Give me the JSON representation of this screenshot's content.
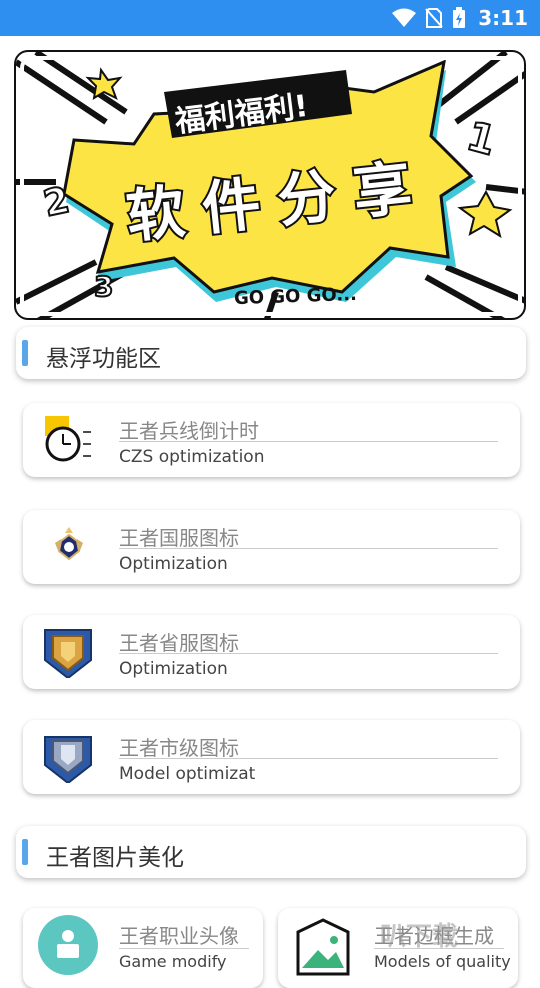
{
  "status_bar": {
    "time": "3:11"
  },
  "banner": {
    "tag_text": "福利福利!",
    "headline": "软件分享",
    "footer_text": "GO GO GO...",
    "numbers": [
      "1",
      "2",
      "3"
    ]
  },
  "sections": [
    {
      "title": "悬浮功能区"
    },
    {
      "title": "王者图片美化"
    }
  ],
  "cards": [
    {
      "title": "王者兵线倒计时",
      "subtitle": "CZS optimization",
      "icon": "stopwatch-icon"
    },
    {
      "title": "王者国服图标",
      "subtitle": "Optimization",
      "icon": "national-server-badge-icon"
    },
    {
      "title": "王者省服图标",
      "subtitle": "Optimization",
      "icon": "province-badge-icon"
    },
    {
      "title": "王者市级图标",
      "subtitle": "Model optimizat",
      "icon": "city-badge-icon"
    }
  ],
  "bottom_cards": [
    {
      "title": "王者职业头像",
      "subtitle": "Game modify",
      "icon": "profession-avatar-icon"
    },
    {
      "title": "王者边框生成",
      "subtitle": "Models of quality",
      "icon": "frame-image-icon"
    }
  ],
  "watermark": "叭下载",
  "colors": {
    "status_bar": "#2f8ff0",
    "accent_bar": "#5aa6ea",
    "banner_yellow": "#fde445"
  }
}
